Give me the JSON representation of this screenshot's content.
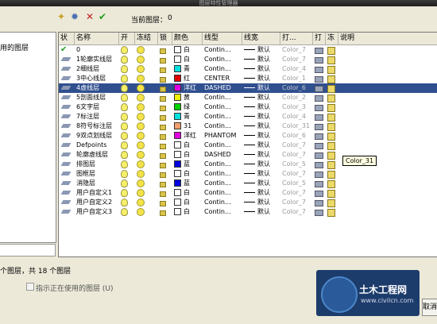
{
  "window": {
    "title": "图层特性管理器"
  },
  "toolbar": {
    "current_layer_label": "当前图层：",
    "current_layer_value": "0",
    "icons": [
      "new-layer-icon",
      "new-layer-frozen-icon",
      "delete-layer-icon",
      "set-current-icon"
    ]
  },
  "tree": {
    "item_label": "用的图层"
  },
  "grid": {
    "columns": [
      "状",
      "名称",
      "开",
      "冻结",
      "锁",
      "颜色",
      "线型",
      "线宽",
      "打...",
      "打",
      "冻",
      "说明"
    ],
    "rows": [
      {
        "name": "0",
        "color_name": "白",
        "color_hex": "#ffffff",
        "linetype": "Contin...",
        "lineweight": "默认",
        "plot_style": "Color_7",
        "current": true
      },
      {
        "name": "1轮廓实线层",
        "color_name": "白",
        "color_hex": "#ffffff",
        "linetype": "Contin...",
        "lineweight": "默认",
        "plot_style": "Color_7"
      },
      {
        "name": "2细线层",
        "color_name": "青",
        "color_hex": "#00e0e0",
        "linetype": "Contin...",
        "lineweight": "默认",
        "plot_style": "Color_4"
      },
      {
        "name": "3中心线层",
        "color_name": "红",
        "color_hex": "#e00000",
        "linetype": "CENTER",
        "lineweight": "默认",
        "plot_style": "Color_1"
      },
      {
        "name": "4虚线层",
        "color_name": "洋红",
        "color_hex": "#e000e0",
        "linetype": "DASHED",
        "lineweight": "默认",
        "plot_style": "Color_6",
        "selected": true
      },
      {
        "name": "5剖面线层",
        "color_name": "黄",
        "color_hex": "#f0f000",
        "linetype": "Contin...",
        "lineweight": "默认",
        "plot_style": "Color_2"
      },
      {
        "name": "6文字层",
        "color_name": "绿",
        "color_hex": "#00d000",
        "linetype": "Contin...",
        "lineweight": "默认",
        "plot_style": "Color_3"
      },
      {
        "name": "7标注层",
        "color_name": "青",
        "color_hex": "#00e0e0",
        "linetype": "Contin...",
        "lineweight": "默认",
        "plot_style": "Color_4"
      },
      {
        "name": "8符号标注层",
        "color_name": "31",
        "color_hex": "#f0a070",
        "linetype": "Contin...",
        "lineweight": "默认",
        "plot_style": "Color_31"
      },
      {
        "name": "9双点划线层",
        "color_name": "洋红",
        "color_hex": "#e000e0",
        "linetype": "PHANTOM",
        "lineweight": "默认",
        "plot_style": "Color_6"
      },
      {
        "name": "Defpoints",
        "color_name": "白",
        "color_hex": "#ffffff",
        "linetype": "Contin...",
        "lineweight": "默认",
        "plot_style": "Color_7"
      },
      {
        "name": "轮廓虚线层",
        "color_name": "白",
        "color_hex": "#ffffff",
        "linetype": "DASHED",
        "lineweight": "默认",
        "plot_style": "Color_7"
      },
      {
        "name": "排图层",
        "color_name": "蓝",
        "color_hex": "#0000e0",
        "linetype": "Contin...",
        "lineweight": "默认",
        "plot_style": "Color_5"
      },
      {
        "name": "图框层",
        "color_name": "白",
        "color_hex": "#ffffff",
        "linetype": "Contin...",
        "lineweight": "默认",
        "plot_style": "Color_7"
      },
      {
        "name": "消隐层",
        "color_name": "蓝",
        "color_hex": "#0000e0",
        "linetype": "Contin...",
        "lineweight": "默认",
        "plot_style": "Color_5"
      },
      {
        "name": "用户自定义1",
        "color_name": "白",
        "color_hex": "#ffffff",
        "linetype": "Contin...",
        "lineweight": "默认",
        "plot_style": "Color_7"
      },
      {
        "name": "用户自定义2",
        "color_name": "白",
        "color_hex": "#ffffff",
        "linetype": "Contin...",
        "lineweight": "默认",
        "plot_style": "Color_7"
      },
      {
        "name": "用户自定义3",
        "color_name": "白",
        "color_hex": "#ffffff",
        "linetype": "Contin...",
        "lineweight": "默认",
        "plot_style": "Color_7"
      }
    ],
    "tooltip": "Color_31"
  },
  "status": {
    "layer_count": "个图层，共 18 个图层",
    "show_in_use_label": "指示正在使用的图层 (U)"
  },
  "watermark": {
    "text": "土木工程网",
    "url": "www.civilcn.com"
  },
  "buttons": {
    "cancel": "取消"
  }
}
